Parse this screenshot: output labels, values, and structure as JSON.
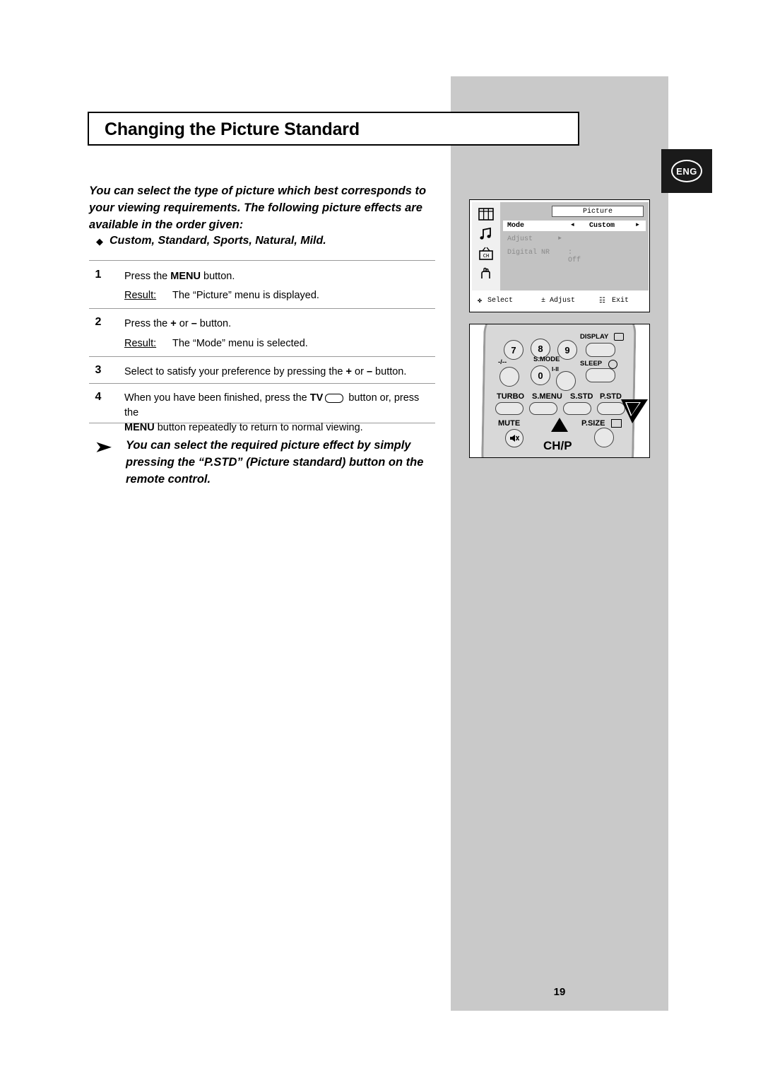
{
  "page": {
    "title": "Changing the Picture Standard",
    "number": "19",
    "lang_badge": "ENG"
  },
  "intro": {
    "paragraph": "You can select the type of picture which best corresponds to your viewing requirements. The following picture effects are available in the order given:",
    "bullet": "Custom, Standard, Sports, Natural, Mild.",
    "bullet_marker": "◆"
  },
  "steps": [
    {
      "num": "1",
      "text_pre": "Press the ",
      "text_bold": "MENU",
      "text_post": " button.",
      "result_label": "Result:",
      "result_text": "The “Picture” menu is displayed."
    },
    {
      "num": "2",
      "text_pre": "Press the ",
      "text_bold": "+",
      "text_mid": " or ",
      "text_bold2": "–",
      "text_post": " button.",
      "result_label": "Result:",
      "result_text": "The “Mode” menu is selected."
    },
    {
      "num": "3",
      "text_pre": "Select to satisfy your preference by pressing the ",
      "text_bold": "+",
      "text_mid": " or ",
      "text_bold2": "–",
      "text_post": " button."
    },
    {
      "num": "4",
      "line1_pre": "When you have been finished, press the ",
      "line1_bold": "TV",
      "line1_post": " button or, press the",
      "line2_bold": "MENU",
      "line2_post": " button repeatedly to return to normal viewing."
    }
  ],
  "note": {
    "arrow": "➤",
    "text": "You can select the required picture effect by simply pressing the “P.STD” (Picture standard) button on the remote control."
  },
  "osd": {
    "title": "Picture",
    "icons": [
      "picture-icon",
      "sound-icon",
      "channel-icon",
      "setup-icon"
    ],
    "rows": [
      {
        "label": "Mode",
        "left_arrow": "◄",
        "value": "Custom",
        "right_arrow": "►",
        "highlighted": true
      },
      {
        "label": "Adjust",
        "value": "►",
        "highlighted": false
      },
      {
        "label": "Digital NR",
        "value": ": Off",
        "highlighted": false
      }
    ],
    "footer": [
      {
        "icon": "✤",
        "label": "Select"
      },
      {
        "icon": "±",
        "label": "Adjust"
      },
      {
        "icon": "☷",
        "label": "Exit"
      }
    ]
  },
  "remote": {
    "number_buttons": [
      "7",
      "8",
      "9",
      "0"
    ],
    "labels": {
      "display": "DISPLAY",
      "smode": "S.MODE",
      "sleep": "SLEEP",
      "dash": "-/--",
      "iII": "I-II",
      "turbo": "TURBO",
      "smenu": "S.MENU",
      "sstd": "S.STD",
      "pstd": "P.STD",
      "mute": "MUTE",
      "psize": "P.SIZE",
      "chp": "CH/P"
    }
  },
  "colors": {
    "grey_column": "#c9c9c9",
    "osd_body": "#c2c2c2",
    "badge_bg": "#1a1a1a"
  }
}
